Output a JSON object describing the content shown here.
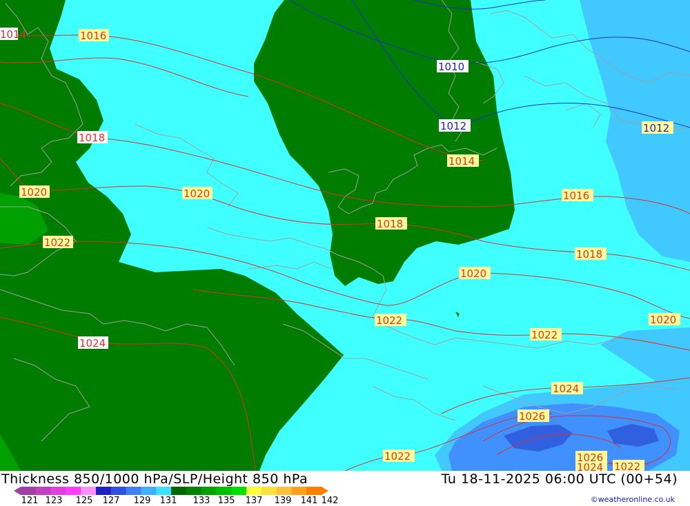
{
  "header": {
    "title": "Thickness 850/1000 hPa/SLP/Height 850 hPa",
    "datetime": "Tu 18-11-2025 06:00 UTC (00+54)"
  },
  "credit": "©weatheronline.co.uk",
  "legend": {
    "ticks": [
      "121",
      "123",
      "125",
      "127",
      "129",
      "131",
      "133",
      "135",
      "137",
      "139",
      "141",
      "142"
    ],
    "colors": [
      "#a040a0",
      "#c040c0",
      "#e040e0",
      "#ff40ff",
      "#ff90ff",
      "#2020c0",
      "#3050e0",
      "#4080f0",
      "#40b0ff",
      "#40e0ff",
      "#006400",
      "#008000",
      "#00a000",
      "#00c000",
      "#00e000",
      "#ffff40",
      "#ffe040",
      "#ffc040",
      "#ffa020",
      "#ff8000"
    ]
  },
  "isobar_labels": [
    {
      "id": "1014-nw",
      "text": "1014",
      "color": "#e03030"
    },
    {
      "id": "1016-nw",
      "text": "1016",
      "color": "#e03030"
    },
    {
      "id": "1018-w",
      "text": "1018",
      "color": "#e03030"
    },
    {
      "id": "1020-w",
      "text": "1020",
      "color": "#e03030"
    },
    {
      "id": "1022-w",
      "text": "1022",
      "color": "#e03030"
    },
    {
      "id": "1024-w",
      "text": "1024",
      "color": "#e03030"
    },
    {
      "id": "1020-c",
      "text": "1020",
      "color": "#e03030"
    },
    {
      "id": "1010-n",
      "text": "1010",
      "color": "#2020c0"
    },
    {
      "id": "1012-n",
      "text": "1012",
      "color": "#2020c0"
    },
    {
      "id": "1012-e",
      "text": "1012",
      "color": "#2020c0"
    },
    {
      "id": "1014-c",
      "text": "1014",
      "color": "#e03030"
    },
    {
      "id": "1016-e",
      "text": "1016",
      "color": "#e03030"
    },
    {
      "id": "1018-c",
      "text": "1018",
      "color": "#e03030"
    },
    {
      "id": "1018-e",
      "text": "1018",
      "color": "#e03030"
    },
    {
      "id": "1020-e",
      "text": "1020",
      "color": "#e03030"
    },
    {
      "id": "1020-far-e",
      "text": "1020",
      "color": "#e03030"
    },
    {
      "id": "1022-c",
      "text": "1022",
      "color": "#e03030"
    },
    {
      "id": "1022-e",
      "text": "1022",
      "color": "#e03030"
    },
    {
      "id": "1024-se",
      "text": "1024",
      "color": "#e03030"
    },
    {
      "id": "1026-se",
      "text": "1026",
      "color": "#e03030"
    },
    {
      "id": "1022-s",
      "text": "1022",
      "color": "#e03030"
    },
    {
      "id": "1026-sse",
      "text": "1026",
      "color": "#e03030"
    },
    {
      "id": "1024-sse",
      "text": "1024",
      "color": "#e03030"
    },
    {
      "id": "1022-sse",
      "text": "1022",
      "color": "#e03030"
    }
  ]
}
